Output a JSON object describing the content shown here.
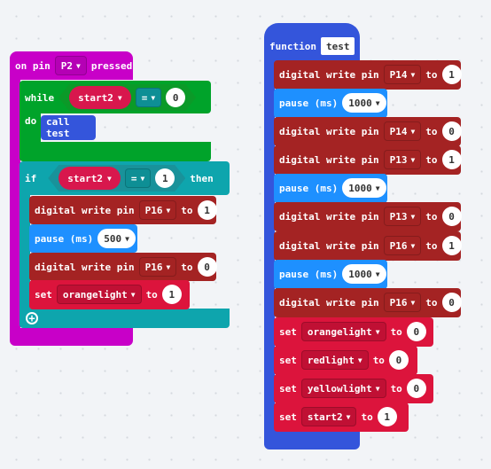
{
  "colors": {
    "event": "#c800c8",
    "loop_green": "#00a32a",
    "logic_teal": "#0ea5ad",
    "pins_red": "#a42323",
    "basic_blue": "#1e90ff",
    "variable_pink": "#dc143c",
    "function_blue": "#3455db"
  },
  "event_block": {
    "prefix": "on pin",
    "pin": "P2",
    "suffix": "pressed",
    "while": {
      "label": "while",
      "do_label": "do",
      "var": "start2",
      "op": "=",
      "value": "0",
      "call_label": "call test"
    },
    "if": {
      "label": "if",
      "then_label": "then",
      "var": "start2",
      "op": "=",
      "value": "1",
      "statements": [
        {
          "text": "digital write pin",
          "pin": "P16",
          "to": "to",
          "value": "1"
        },
        {
          "text": "pause (ms)",
          "value": "500"
        },
        {
          "text": "digital write pin",
          "pin": "P16",
          "to": "to",
          "value": "0"
        },
        {
          "text": "set",
          "var": "orangelight",
          "to": "to",
          "value": "1"
        }
      ]
    },
    "add_icon": "plus-circle-icon"
  },
  "function_block": {
    "label": "function",
    "name": "test",
    "statements": [
      {
        "type": "dw",
        "text": "digital write pin",
        "pin": "P14",
        "to": "to",
        "value": "1"
      },
      {
        "type": "pause",
        "text": "pause (ms)",
        "value": "1000"
      },
      {
        "type": "dw",
        "text": "digital write pin",
        "pin": "P14",
        "to": "to",
        "value": "0"
      },
      {
        "type": "dw",
        "text": "digital write pin",
        "pin": "P13",
        "to": "to",
        "value": "1"
      },
      {
        "type": "pause",
        "text": "pause (ms)",
        "value": "1000"
      },
      {
        "type": "dw",
        "text": "digital write pin",
        "pin": "P13",
        "to": "to",
        "value": "0"
      },
      {
        "type": "dw",
        "text": "digital write pin",
        "pin": "P16",
        "to": "to",
        "value": "1"
      },
      {
        "type": "pause",
        "text": "pause (ms)",
        "value": "1000"
      },
      {
        "type": "dw",
        "text": "digital write pin",
        "pin": "P16",
        "to": "to",
        "value": "0"
      },
      {
        "type": "set",
        "text": "set",
        "var": "orangelight",
        "to": "to",
        "value": "0"
      },
      {
        "type": "set",
        "text": "set",
        "var": "redlight",
        "to": "to",
        "value": "0"
      },
      {
        "type": "set",
        "text": "set",
        "var": "yellowlight",
        "to": "to",
        "value": "0"
      },
      {
        "type": "set",
        "text": "set",
        "var": "start2",
        "to": "to",
        "value": "1"
      }
    ]
  }
}
